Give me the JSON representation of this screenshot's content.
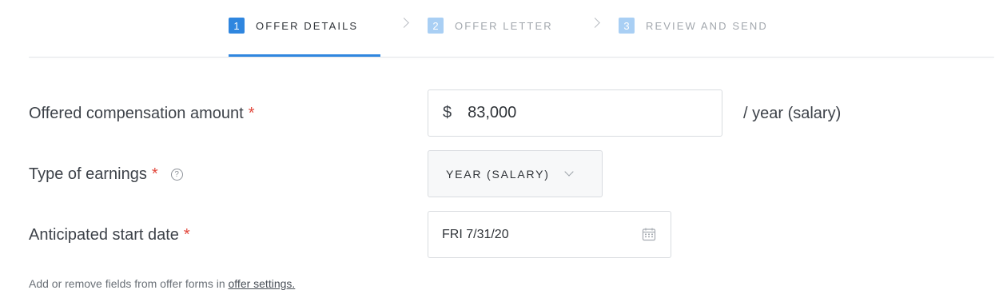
{
  "stepper": {
    "steps": [
      {
        "number": "1",
        "label": "OFFER DETAILS",
        "state": "active"
      },
      {
        "number": "2",
        "label": "OFFER LETTER",
        "state": "inactive"
      },
      {
        "number": "3",
        "label": "REVIEW AND SEND",
        "state": "inactive"
      }
    ]
  },
  "form": {
    "compensation": {
      "label": "Offered compensation amount",
      "required_marker": "*",
      "currency_symbol": "$",
      "value": "83,000",
      "unit": "/ year (salary)"
    },
    "earnings_type": {
      "label": "Type of earnings",
      "required_marker": "*",
      "help_icon": "?",
      "selected": "YEAR (SALARY)"
    },
    "start_date": {
      "label": "Anticipated start date",
      "required_marker": "*",
      "value": "FRI 7/31/20",
      "icon": "calendar-icon"
    }
  },
  "footer": {
    "text": "Add or remove fields from offer forms in ",
    "link": "offer settings."
  },
  "colors": {
    "accent": "#2f86df",
    "accent_light": "#a9cff4",
    "required": "#e2473c"
  }
}
